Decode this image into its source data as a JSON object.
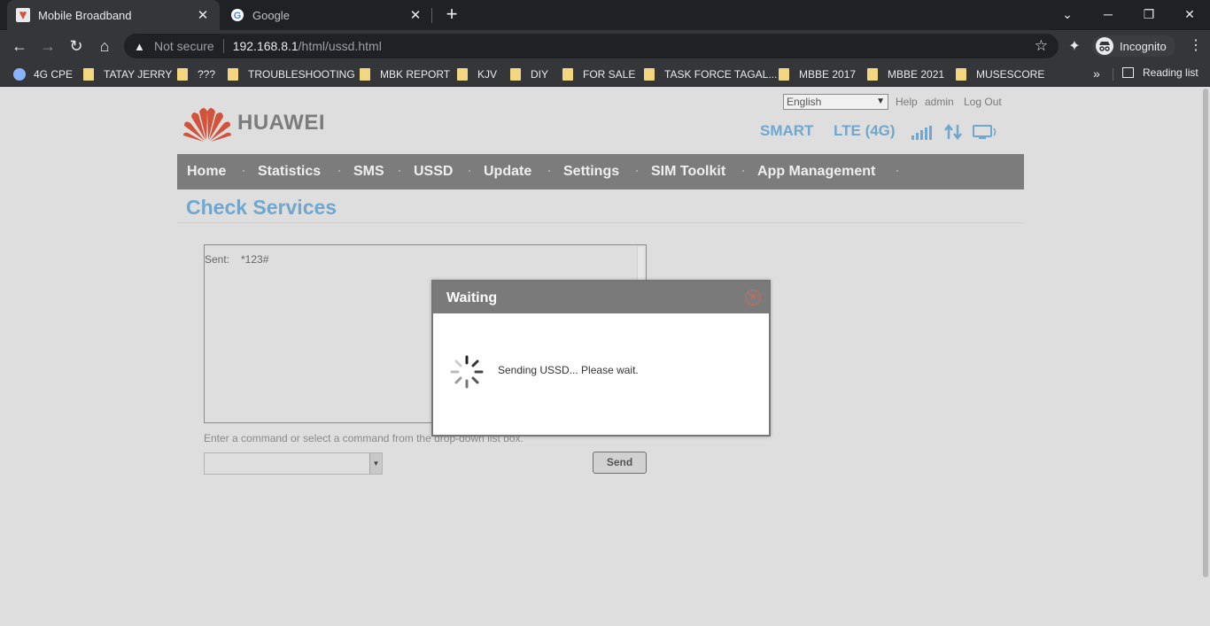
{
  "browser": {
    "tabs": [
      {
        "title": "Mobile Broadband",
        "active": true
      },
      {
        "title": "Google",
        "active": false
      }
    ],
    "address": {
      "security_label": "Not secure",
      "host": "192.168.8.1",
      "path": "/html/ussd.html"
    },
    "profile_label": "Incognito",
    "bookmarks": [
      {
        "label": "4G CPE",
        "icon": "globe-icon"
      },
      {
        "label": "TATAY JERRY",
        "icon": "folder-icon"
      },
      {
        "label": "???",
        "icon": "folder-icon"
      },
      {
        "label": "TROUBLESHOOTING",
        "icon": "folder-icon"
      },
      {
        "label": "MBK REPORT",
        "icon": "folder-icon"
      },
      {
        "label": "KJV",
        "icon": "folder-icon"
      },
      {
        "label": "DIY",
        "icon": "folder-icon"
      },
      {
        "label": "FOR SALE",
        "icon": "folder-icon"
      },
      {
        "label": "TASK FORCE TAGAL...",
        "icon": "folder-icon"
      },
      {
        "label": "MBBE 2017",
        "icon": "folder-icon"
      },
      {
        "label": "MBBE 2021",
        "icon": "folder-icon"
      },
      {
        "label": "MUSESCORE",
        "icon": "folder-icon"
      }
    ],
    "reading_list_label": "Reading list",
    "more_bookmarks": "»"
  },
  "page": {
    "brand": "HUAWEI",
    "language": "English",
    "top_links": {
      "help": "Help",
      "admin": "admin",
      "logout": "Log Out"
    },
    "status": {
      "operator": "SMART",
      "network": "LTE (4G)"
    },
    "menu": [
      "Home",
      "Statistics",
      "SMS",
      "USSD",
      "Update",
      "Settings",
      "SIM Toolkit",
      "App Management"
    ],
    "title": "Check Services",
    "ussd_log": {
      "sent_label": "Sent:",
      "sent_value": "*123#"
    },
    "hint": "Enter a command or select a command from the drop-down list box.",
    "send_label": "Send"
  },
  "modal": {
    "title": "Waiting",
    "message": "Sending USSD... Please wait."
  },
  "colors": {
    "accent_blue": "#6fa7cf",
    "menu_gray": "#7c7c7c",
    "huawei_red": "#d2523b"
  }
}
